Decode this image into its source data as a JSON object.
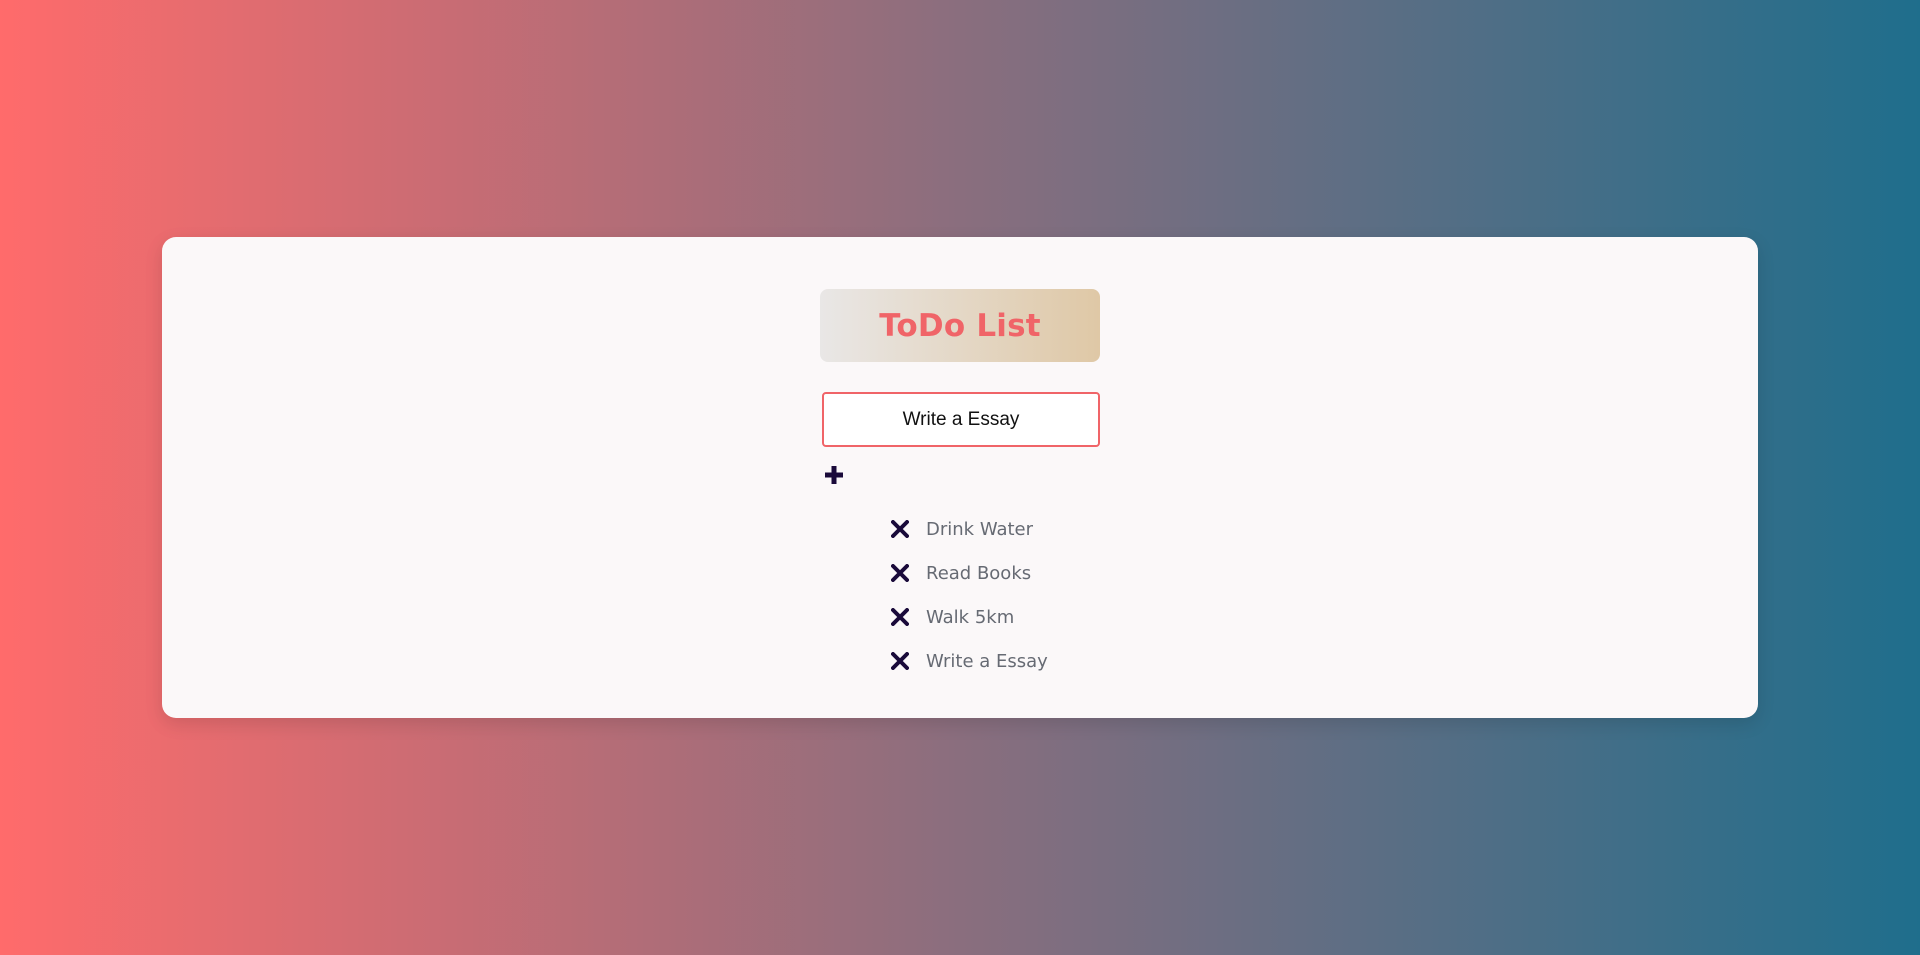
{
  "app": {
    "title": "ToDo List"
  },
  "input": {
    "value": "Write a Essay",
    "placeholder": ""
  },
  "icons": {
    "add": "plus-icon",
    "remove": "close-icon"
  },
  "todos": [
    {
      "text": "Drink Water"
    },
    {
      "text": "Read Books"
    },
    {
      "text": "Walk 5km"
    },
    {
      "text": "Write a Essay"
    }
  ],
  "colors": {
    "accent": "#f06468",
    "icon": "#1a0a3a",
    "text": "#666a73",
    "card": "#fbf8f9"
  }
}
